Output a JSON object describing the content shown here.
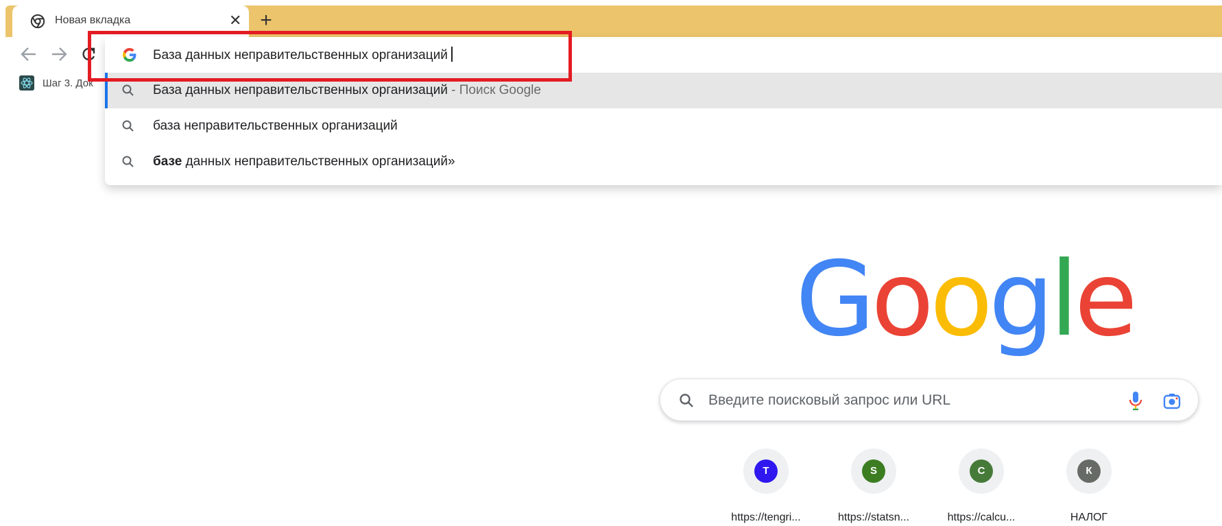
{
  "tab": {
    "title": "Новая вкладка",
    "close_glyph": "✕",
    "favicon": "chrome-icon"
  },
  "new_tab_glyph": "+",
  "toolbar": {
    "back_icon": "arrow-left-icon",
    "forward_icon": "arrow-right-icon",
    "reload_icon": "reload-icon"
  },
  "bookmarks": [
    {
      "label": "Шаг 3. Док",
      "icon": "react-icon"
    }
  ],
  "omnibox": {
    "value": "База данных неправительственных организаций",
    "icon": "google-g-icon",
    "suggestions": [
      {
        "text": "База данных неправительственных организаций",
        "suffix": " - Поиск Google",
        "selected": true
      },
      {
        "text": "база неправительственных организаций",
        "selected": false
      },
      {
        "bold": "базе",
        "text": " данных неправительственных организаций»",
        "selected": false
      }
    ]
  },
  "logo": {
    "letters": [
      "G",
      "o",
      "o",
      "g",
      "l",
      "e"
    ],
    "colors": [
      "#4285f4",
      "#ea4335",
      "#fbbc05",
      "#4285f4",
      "#34a853",
      "#ea4335"
    ]
  },
  "search": {
    "placeholder": "Введите поисковый запрос или URL",
    "mic_icon": "microphone-icon",
    "lens_icon": "camera-lens-icon"
  },
  "shortcuts": [
    {
      "letter": "T",
      "label": "https://tengri...",
      "color": "#2f17f0"
    },
    {
      "letter": "S",
      "label": "https://statsn...",
      "color": "#3c7d22"
    },
    {
      "letter": "C",
      "label": "https://calcu...",
      "color": "#467a39"
    },
    {
      "letter": "К",
      "label": "НАЛОГ",
      "color": "#666b66"
    }
  ],
  "colors": {
    "tabstrip": "#ecc46b",
    "annotation": "#e31b23",
    "selected_row": "#e6e6e6",
    "accent": "#1a73e8"
  }
}
